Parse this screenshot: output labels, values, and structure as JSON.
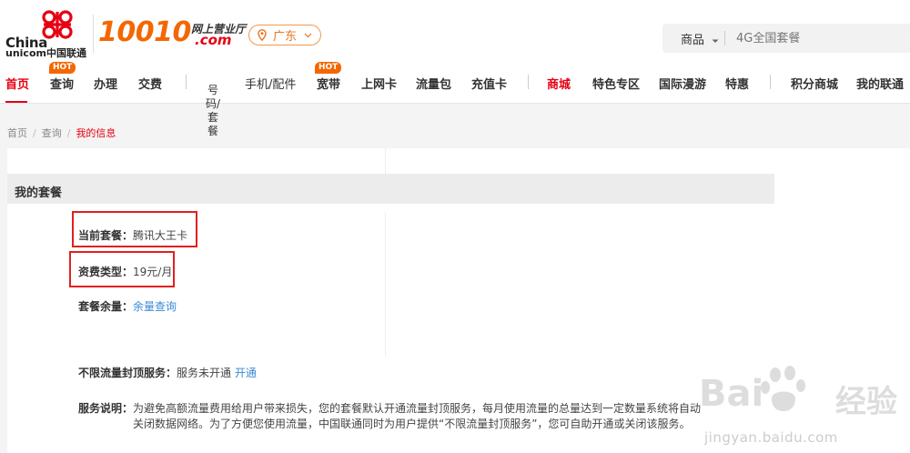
{
  "header": {
    "logo_line1": "China",
    "logo_line2": "unicom中国联通",
    "brand_number": "10010",
    "brand_hall": "网上营业厅",
    "brand_domain": ".com",
    "location": "广东",
    "search": {
      "category": "商品",
      "placeholder": "4G全国套餐"
    }
  },
  "nav": {
    "items": [
      {
        "label": "首页",
        "active": true
      },
      {
        "label": "查询",
        "hot": true
      },
      {
        "label": "办理"
      },
      {
        "label": "交费"
      },
      {
        "label": "号码/套餐"
      },
      {
        "label": "手机/配件"
      },
      {
        "label": "宽带",
        "hot": true
      },
      {
        "label": "上网卡"
      },
      {
        "label": "流量包"
      },
      {
        "label": "充值卡"
      },
      {
        "label": "商城",
        "highlight": true
      },
      {
        "label": "特色专区"
      },
      {
        "label": "国际漫游"
      },
      {
        "label": "特惠"
      },
      {
        "label": "积分商城"
      },
      {
        "label": "我的联通"
      }
    ],
    "hot_badge": "HOT"
  },
  "breadcrumb": {
    "items": [
      "首页",
      "查询",
      "我的信息"
    ],
    "separator": "/"
  },
  "package_section": {
    "title": "我的套餐",
    "current_package_label": "当前套餐：",
    "current_package_value": "腾讯大王卡",
    "fee_type_label": "资费类型：",
    "fee_type_value": "19元/月",
    "balance_label": "套餐余量：",
    "balance_link": "余量查询",
    "cap_service_label": "不限流量封顶服务：",
    "cap_service_status": "服务未开通",
    "cap_service_link": "开通",
    "description_label": "服务说明：",
    "description_text": "为避免高额流量费用给用户带来损失，您的套餐默认开通流量封顶服务，每月使用流量的总量达到一定数量系统将自动关闭数据网络。为了方便您使用流量，中国联通同时为用户提供“不限流量封顶服务”，您可自助开通或关闭该服务。"
  },
  "watermark": {
    "brand": "Bai",
    "brand_du": "du",
    "jingyan": "经验",
    "url": "jingyan.baidu.com"
  },
  "colors": {
    "brand_orange": "#f46700",
    "brand_red": "#e60012",
    "link_blue": "#3a8ad6",
    "highlight_box": "#e02020"
  }
}
